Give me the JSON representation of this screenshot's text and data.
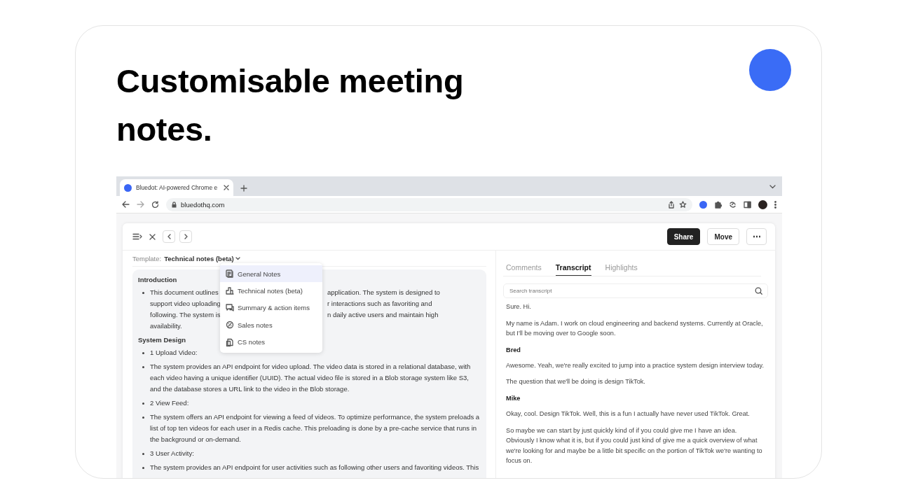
{
  "headline": "Customisable meeting notes.",
  "browser": {
    "tab_title": "Bluedot: AI-powered Chrome e",
    "url": "bluedothq.com"
  },
  "toolbar_buttons": [
    {
      "label": "Share",
      "kind": "primary"
    },
    {
      "label": "Move",
      "kind": "secondary"
    },
    {
      "label": "⋯",
      "kind": "more"
    }
  ],
  "template": {
    "label": "Template:",
    "value": "Technical notes (beta)"
  },
  "template_menu": [
    {
      "label": "General Notes",
      "selected": true
    },
    {
      "label": "Technical notes (beta)",
      "selected": false
    },
    {
      "label": "Summary & action items",
      "selected": false
    },
    {
      "label": "Sales notes",
      "selected": false
    },
    {
      "label": "CS notes",
      "selected": false
    }
  ],
  "notes": [
    {
      "kind": "heading",
      "text": "Introduction"
    },
    {
      "kind": "covered_bullet",
      "lines": [
        [
          "This document outlines",
          "application. The system is designed to"
        ],
        [
          "support video uploading",
          "r interactions such as favoriting and"
        ],
        [
          "following. The system is",
          "n daily active users and maintain high"
        ],
        [
          "availability."
        ]
      ]
    },
    {
      "kind": "heading",
      "text": "System Design"
    },
    {
      "kind": "bullet",
      "text": "1 Upload Video:"
    },
    {
      "kind": "bullet",
      "text": "The system provides an API endpoint for video upload. The video data is stored in a relational database, with each video having a unique identifier (UUID). The actual video file is stored in a Blob storage system like S3, and the database stores a URL link to the video in the Blob storage."
    },
    {
      "kind": "bullet",
      "text": "2 View Feed:"
    },
    {
      "kind": "bullet",
      "text": "The system offers an API endpoint for viewing a feed of videos. To optimize performance, the system preloads a list of top ten videos for each user in a Redis cache. This preloading is done by a pre-cache service that runs in the background or on-demand."
    },
    {
      "kind": "bullet",
      "text": "3 User Activity:"
    },
    {
      "kind": "bullet",
      "text": "The system provides an API endpoint for user activities such as following other users and favoriting videos. This"
    }
  ],
  "transcript": {
    "tabs": [
      {
        "label": "Comments",
        "selected": false
      },
      {
        "label": "Transcript",
        "selected": true
      },
      {
        "label": "Highlights",
        "selected": false
      }
    ],
    "search": {
      "placeholder": "Search transcript"
    },
    "entries": [
      {
        "kind": "line",
        "text": "Sure. Hi."
      },
      {
        "kind": "line",
        "text": "My name is Adam. I work on cloud engineering and backend systems. Currently at Oracle, but I'll be moving over to Google soon."
      },
      {
        "kind": "speaker",
        "text": "Bred"
      },
      {
        "kind": "line",
        "text": "Awesome. Yeah, we're really excited to jump into a practice system design interview today."
      },
      {
        "kind": "line",
        "text": "The question that we'll be doing is design TikTok."
      },
      {
        "kind": "speaker",
        "text": "Mike"
      },
      {
        "kind": "line",
        "text": "Okay, cool. Design TikTok. Well, this is a fun I actually have never used TikTok. Great."
      },
      {
        "kind": "line",
        "text": "So maybe we can start by just quickly kind of if you could give me I have an idea. Obviously I know what it is, but if you could just kind of give me a quick overview of what we're looking for and maybe be a little bit specific on the portion of TikTok we're wanting to focus on."
      }
    ]
  }
}
